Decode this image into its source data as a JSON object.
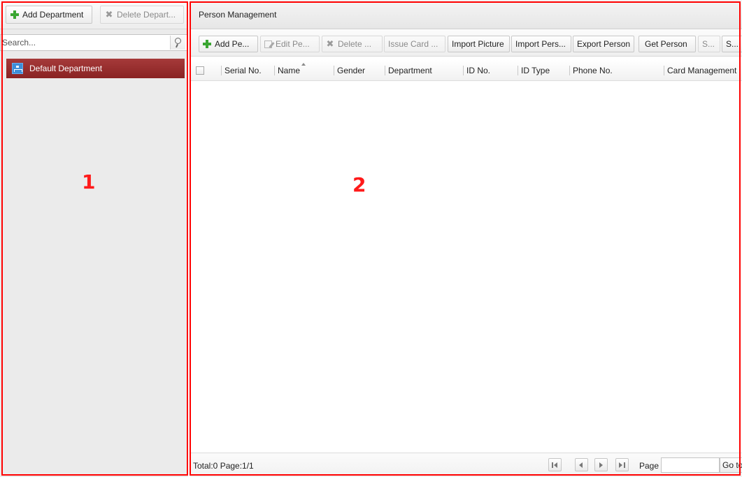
{
  "left_panel": {
    "toolbar": {
      "add_department": "Add Department",
      "delete_department": "Delete Depart..."
    },
    "search": {
      "placeholder": "Search...",
      "value": ""
    },
    "tree": {
      "items": [
        {
          "label": "Default Department",
          "selected": true
        }
      ]
    }
  },
  "right_panel": {
    "title": "Person Management",
    "toolbar": {
      "add_person": "Add Pe...",
      "edit_person": "Edit Pe...",
      "delete_person": "Delete ...",
      "issue_card": "Issue Card ...",
      "import_picture": "Import Picture",
      "import_person": "Import Pers...",
      "export_person": "Export Person",
      "get_person": "Get Person",
      "btn_s1": "S...",
      "btn_s2": "S..."
    },
    "table": {
      "columns": [
        "Serial No.",
        "Name",
        "Gender",
        "Department",
        "ID No.",
        "ID Type",
        "Phone No.",
        "Card Management"
      ],
      "rows": []
    },
    "footer": {
      "total": "Total:0  Page:1/1",
      "page_label": "Page",
      "page_input_value": "",
      "goto_label": "Go to"
    }
  },
  "annotations": {
    "label_1": "1",
    "label_2": "2"
  },
  "colors": {
    "annotation": "#ff0000",
    "selected_row": "#8f2727",
    "add_icon": "#3aa632"
  }
}
